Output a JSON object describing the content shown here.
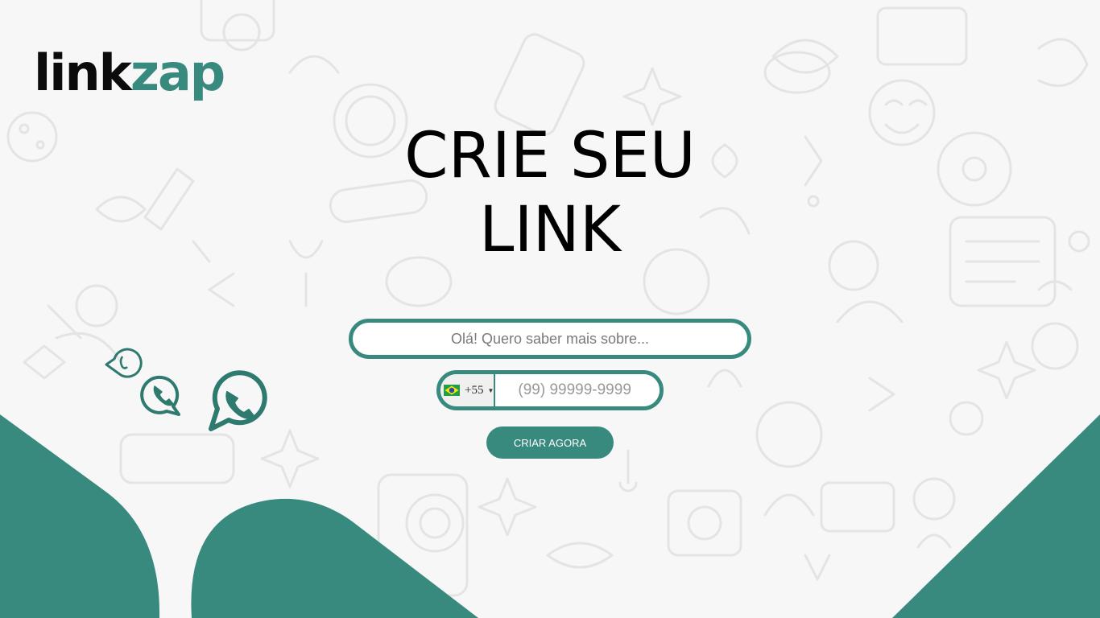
{
  "brand": {
    "logo_part1": "link",
    "logo_part2": "zap"
  },
  "hero": {
    "line1": "CRIE SEU",
    "line2": "LINK"
  },
  "form": {
    "message_placeholder": "Olá! Quero saber mais sobre...",
    "country_code": "+55",
    "phone_placeholder": "(99) 99999-9999",
    "submit_label": "CRIAR AGORA"
  },
  "colors": {
    "accent": "#388a7e",
    "doodle": "#e6e6e6"
  },
  "icons": [
    "phone-bubble-icon",
    "whatsapp-icon",
    "brazil-flag-icon",
    "caret-down-icon"
  ]
}
